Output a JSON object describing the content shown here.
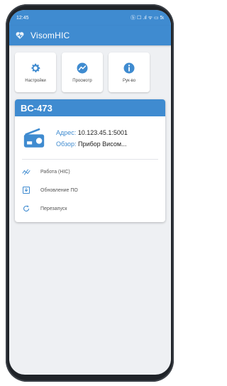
{
  "status_bar": {
    "time": "12:45",
    "indicators": "ⓑ ☐ .ıl ᯤ ▭ 5ɩ"
  },
  "app_bar": {
    "title": "VisomHIC",
    "logo_icon": "heart-logo"
  },
  "tiles": [
    {
      "label": "Настройки",
      "icon": "gear-icon"
    },
    {
      "label": "Просмотр",
      "icon": "chart-circle-icon"
    },
    {
      "label": "Рук-во",
      "icon": "info-icon"
    }
  ],
  "device_card": {
    "name": "BC-473",
    "address_label": "Адрес:",
    "address_value": "10.123.45.1:5001",
    "overview_label": "Обзор:",
    "overview_value": "Прибор Висом..."
  },
  "menu": [
    {
      "label": "Работа (HIC)",
      "icon": "wave-icon"
    },
    {
      "label": "Обновление ПО",
      "icon": "download-icon"
    },
    {
      "label": "Перезапуск",
      "icon": "refresh-icon"
    }
  ],
  "colors": {
    "accent": "#3f8bd0",
    "background": "#eef0f3"
  }
}
